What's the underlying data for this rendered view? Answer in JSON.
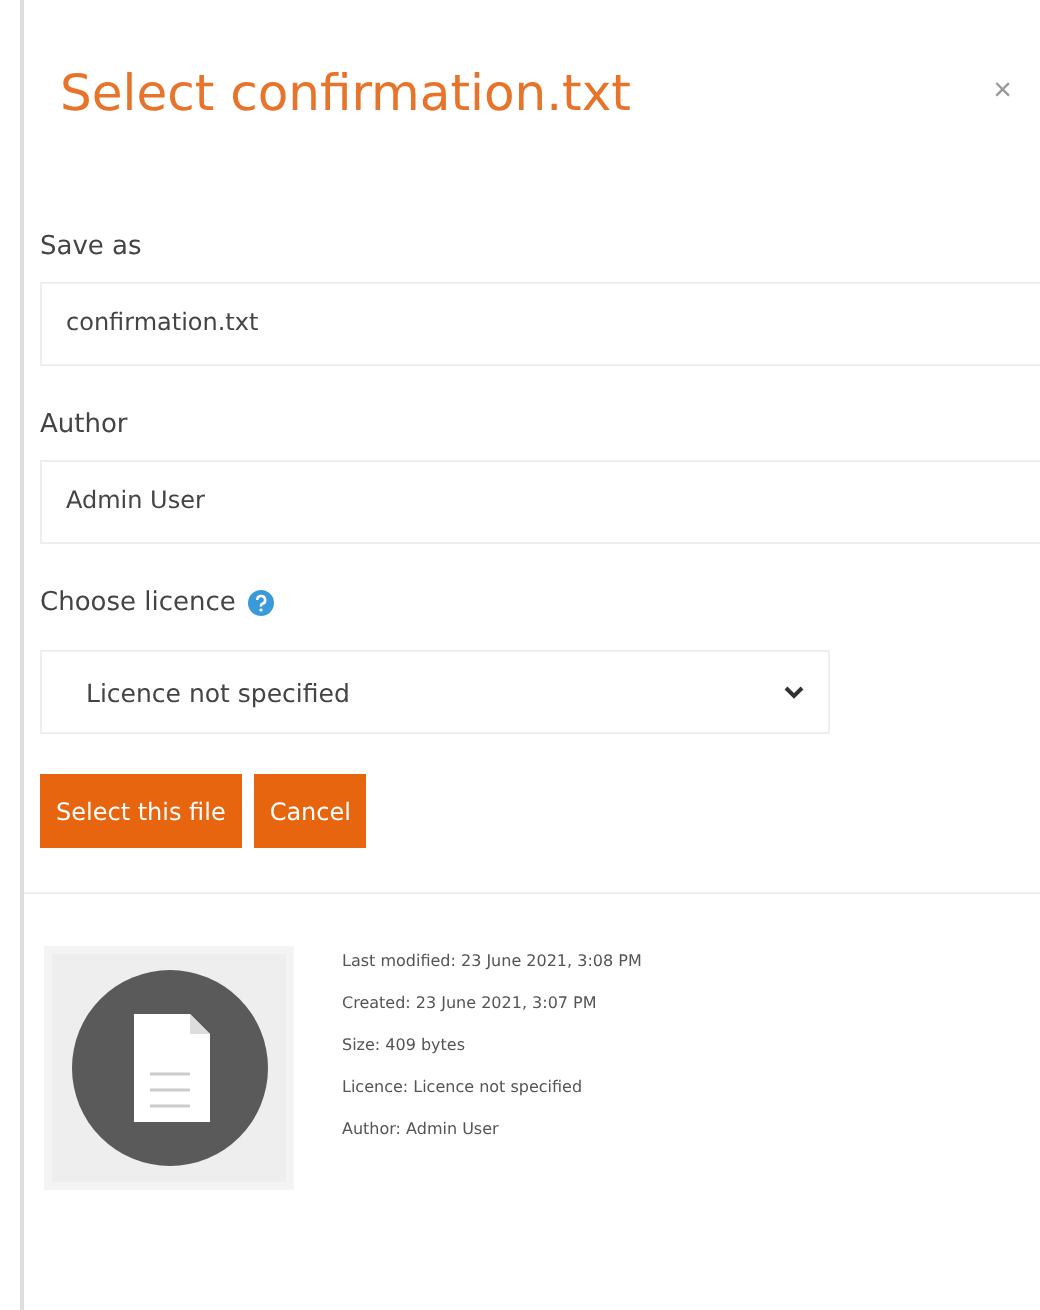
{
  "dialog": {
    "title": "Select confirmation.txt",
    "close": "×"
  },
  "fields": [
    {
      "kind": "text",
      "label": "Save as",
      "value": "confirmation.txt"
    },
    {
      "kind": "text",
      "label": "Author",
      "value": "Admin User"
    },
    {
      "kind": "select",
      "label": "Choose licence",
      "help": true,
      "value": "Licence not specified"
    }
  ],
  "buttons": [
    "Select this file",
    "Cancel"
  ],
  "details": [
    "Last modified: 23 June 2021, 3:08 PM",
    "Created: 23 June 2021, 3:07 PM",
    "Size: 409 bytes",
    "Licence: Licence not specified",
    "Author: Admin User"
  ]
}
